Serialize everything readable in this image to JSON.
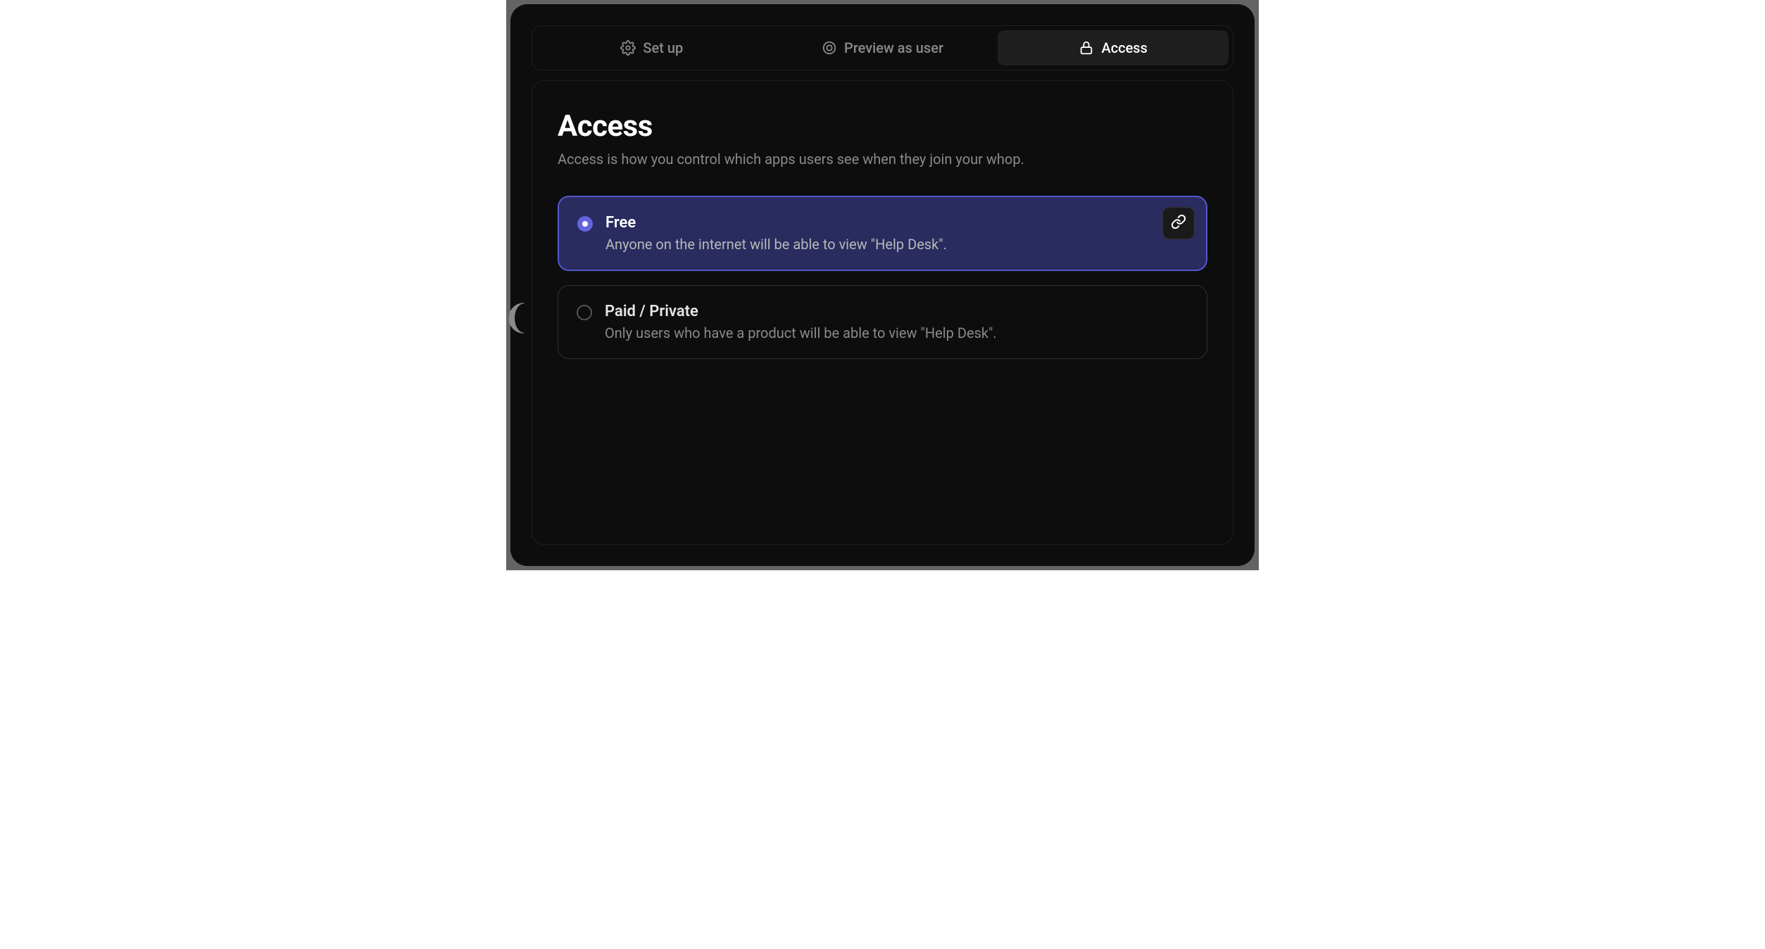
{
  "tabs": {
    "setup": "Set up",
    "preview": "Preview as user",
    "access": "Access"
  },
  "page": {
    "title": "Access",
    "description": "Access is how you control which apps users see when they join your whop."
  },
  "options": {
    "free": {
      "title": "Free",
      "description": "Anyone on the internet will be able to view \"Help Desk\"."
    },
    "paid": {
      "title": "Paid / Private",
      "description": "Only users who have a product will be able to view \"Help Desk\"."
    }
  }
}
